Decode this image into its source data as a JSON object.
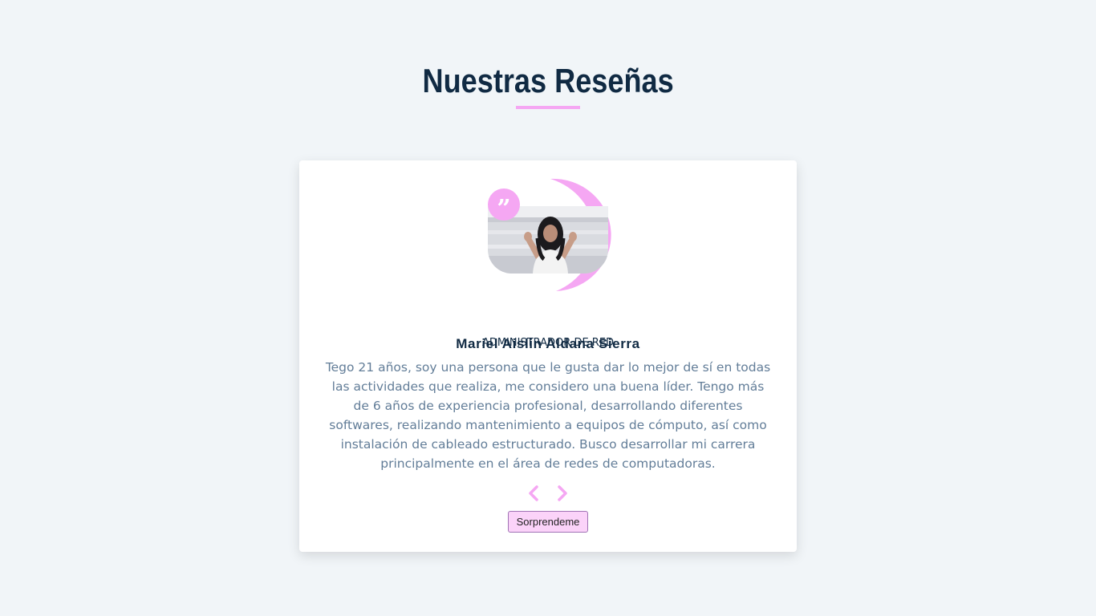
{
  "section": {
    "title": "Nuestras Reseñas"
  },
  "review": {
    "author": "Mariel Aislin Aldana Sierra",
    "job": "ADMINISTRADOR DE RED",
    "text": "Tego 21 años, soy una persona que le gusta dar lo mejor de sí en todas las actividades que realiza, me considero una buena líder. Tengo más de 6 años de experiencia profesional, desarrollando diferentes softwares, realizando mantenimiento a equipos de cómputo, así como instalación de cableado estructurado. Busco desarrollar mi carrera principalmente en el área de redes de computadoras.",
    "quote_icon": "quote-right-icon"
  },
  "controls": {
    "prev_icon": "chevron-left-icon",
    "next_icon": "chevron-right-icon",
    "random_label": "Sorprendeme"
  },
  "colors": {
    "accent": "#f5a7f3",
    "title": "#102a43",
    "text": "#627d98",
    "background": "#f1f5f8",
    "button_bg": "#fbd3f9"
  }
}
